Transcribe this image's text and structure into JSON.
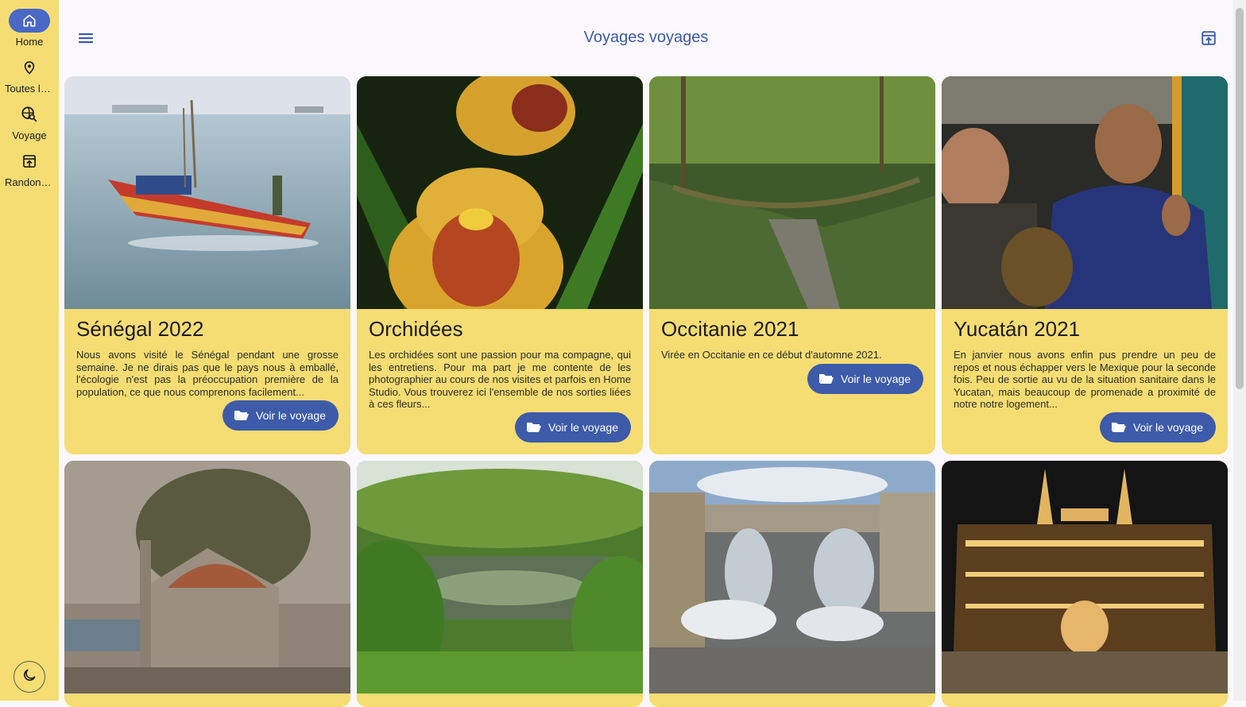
{
  "nav": {
    "items": [
      {
        "label": "Home",
        "icon": "home-icon"
      },
      {
        "label": "Toutes les destinations",
        "icon": "map-pin-icon"
      },
      {
        "label": "Voyage",
        "icon": "globe-search-icon"
      },
      {
        "label": "Randonnées",
        "icon": "export-icon"
      }
    ],
    "theme_icon": "moon-icon"
  },
  "header": {
    "title": "Voyages voyages",
    "menu_icon": "hamburger-icon",
    "export_icon": "export-icon"
  },
  "cards": [
    {
      "title": "Sénégal 2022",
      "description": "Nous avons visité le Sénégal pendant une grosse semaine. Je ne dirais pas que le pays nous à emballé, l'écologie n'est pas la préoccupation première de la population, ce que nous comprenons facilement...",
      "button": "Voir le voyage"
    },
    {
      "title": "Orchidées",
      "description": "Les orchidées sont une passion pour ma compagne, qui les entretiens. Pour ma part je me contente de les photographier au cours de nos visites et parfois en Home Studio. Vous trouverez ici l'ensemble de nos sorties liées à ces fleurs...",
      "button": "Voir le voyage"
    },
    {
      "title": "Occitanie 2021",
      "description": "Virée en Occitanie en ce début d'automne 2021.",
      "button": "Voir le voyage"
    },
    {
      "title": "Yucatán 2021",
      "description": "En janvier nous avons enfin pus prendre un peu de repos et nous échapper vers le Mexique pour la seconde fois. Peu de sortie au vu de la situation sanitaire dans le Yucatan, mais beaucoup de promenade a proximité de notre notre logement...",
      "button": "Voir le voyage"
    }
  ],
  "colors": {
    "rail_background": "#f5dd73",
    "card_background": "#f5dd73",
    "accent": "#3d5ba9",
    "active_indicator": "#4a68c6",
    "page_background": "#fbf8fd"
  }
}
